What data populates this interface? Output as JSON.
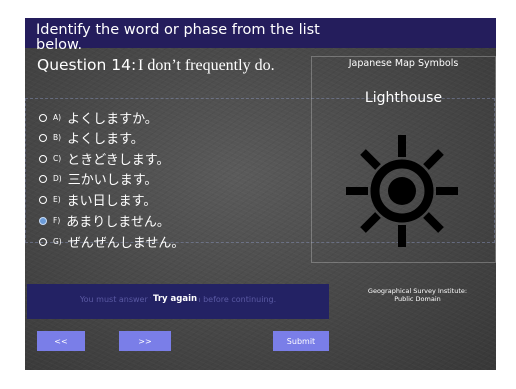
{
  "quiz": {
    "instruction": "Identify the word or phase from the list below.",
    "question_label": "Question 14:",
    "question_text": "I don’t frequently do.",
    "options": [
      {
        "letter": "A)",
        "text": "よくしますか。",
        "selected": false
      },
      {
        "letter": "B)",
        "text": "よくします。",
        "selected": false
      },
      {
        "letter": "C)",
        "text": "ときどきします。",
        "selected": false
      },
      {
        "letter": "D)",
        "text": "三かいします。",
        "selected": false
      },
      {
        "letter": "E)",
        "text": "まい日します。",
        "selected": false
      },
      {
        "letter": "F)",
        "text": "あまりしません。",
        "selected": true
      },
      {
        "letter": "G)",
        "text": "ぜんぜんしません。",
        "selected": false
      }
    ],
    "accent_color": "#241d5c",
    "button_color": "#7a7ee8"
  },
  "map_panel": {
    "header": "Japanese Map Symbols",
    "symbol_name": "Lighthouse",
    "symbol_icon": "lighthouse-symbol-icon",
    "credit_line1": "Geographical Survey Institute:",
    "credit_line2": "Public Domain"
  },
  "feedback": {
    "message": "You must answer the question before continuing.",
    "try_again": "Try again"
  },
  "nav": {
    "prev_label": "<<",
    "next_label": ">>",
    "submit_label": "Submit"
  }
}
